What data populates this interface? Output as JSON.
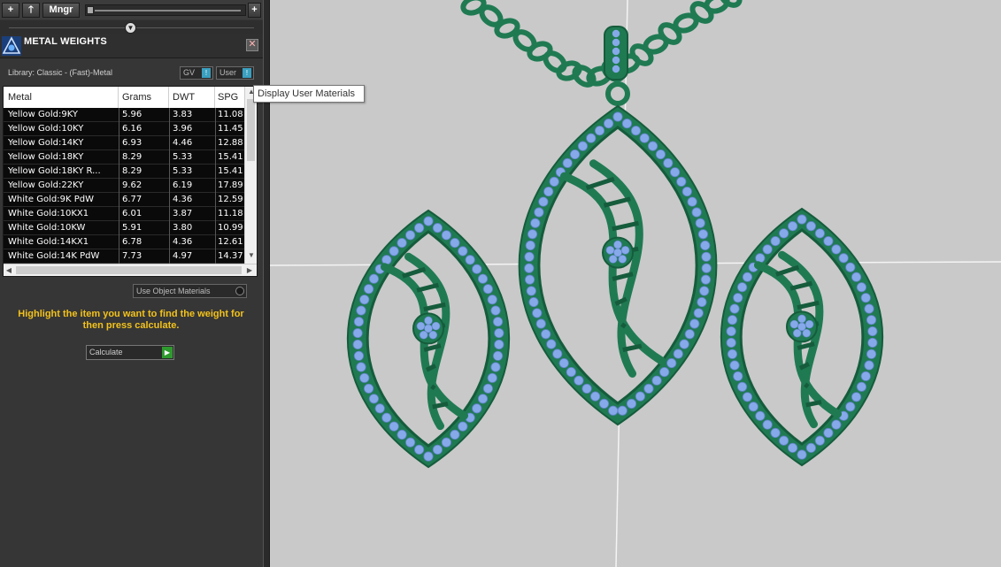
{
  "toolbar": {
    "add_label": "+",
    "up_label": "🡑",
    "manager_label": "Mngr",
    "plus_label": "+"
  },
  "panel": {
    "title": "METAL WEIGHTS",
    "library_label": "Library: Classic - (Fast)-Metal",
    "gv_label": "GV",
    "user_label": "User",
    "toggle_indicator": "!",
    "close_label": "✕"
  },
  "table": {
    "columns": [
      "Metal",
      "Grams",
      "DWT",
      "SPG"
    ],
    "rows": [
      {
        "metal": "Yellow Gold:9KY",
        "grams": "5.96",
        "dwt": "3.83",
        "spg": "11.08"
      },
      {
        "metal": "Yellow Gold:10KY",
        "grams": "6.16",
        "dwt": "3.96",
        "spg": "11.45"
      },
      {
        "metal": "Yellow Gold:14KY",
        "grams": "6.93",
        "dwt": "4.46",
        "spg": "12.88"
      },
      {
        "metal": "Yellow Gold:18KY",
        "grams": "8.29",
        "dwt": "5.33",
        "spg": "15.41"
      },
      {
        "metal": "Yellow Gold:18KY R...",
        "grams": "8.29",
        "dwt": "5.33",
        "spg": "15.41"
      },
      {
        "metal": "Yellow Gold:22KY",
        "grams": "9.62",
        "dwt": "6.19",
        "spg": "17.89"
      },
      {
        "metal": "White Gold:9K PdW",
        "grams": "6.77",
        "dwt": "4.36",
        "spg": "12.59"
      },
      {
        "metal": "White Gold:10KX1",
        "grams": "6.01",
        "dwt": "3.87",
        "spg": "11.18"
      },
      {
        "metal": "White Gold:10KW",
        "grams": "5.91",
        "dwt": "3.80",
        "spg": "10.99"
      },
      {
        "metal": "White Gold:14KX1",
        "grams": "6.78",
        "dwt": "4.36",
        "spg": "12.61"
      },
      {
        "metal": "White Gold:14K PdW",
        "grams": "7.73",
        "dwt": "4.97",
        "spg": "14.37"
      }
    ]
  },
  "use_object_materials_label": "Use Object Materials",
  "instruction": "Highlight the item you want to find the weight for then press calculate.",
  "calculate_label": "Calculate",
  "tooltip": "Display User Materials",
  "colors": {
    "metal": "#1f7a52",
    "metal_dark": "#155c3c",
    "gem": "#86a9ea",
    "accent_text": "#f2c21c",
    "panel_bg": "#363636",
    "viewport_bg": "#c9c9c9"
  }
}
